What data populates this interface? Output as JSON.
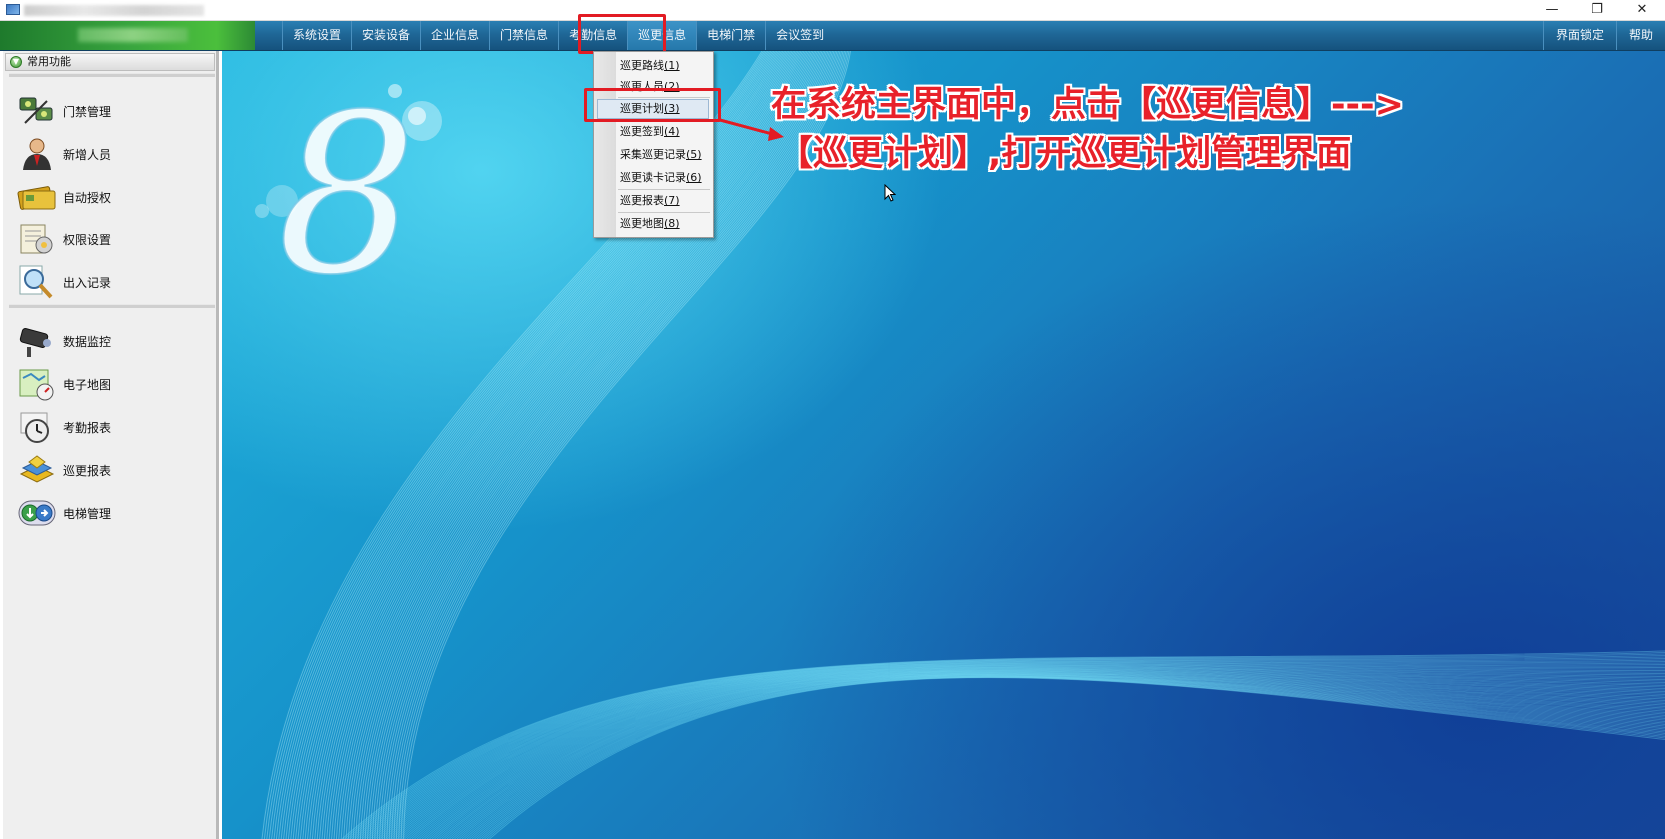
{
  "window": {
    "controls": [
      "—",
      "❐",
      "✕"
    ]
  },
  "menu": {
    "items": [
      "系统设置",
      "安装设备",
      "企业信息",
      "门禁信息",
      "考勤信息",
      "巡更信息",
      "电梯门禁",
      "会议签到"
    ],
    "right_items": [
      "界面锁定",
      "帮助"
    ],
    "active": "巡更信息"
  },
  "sidebar": {
    "title": "常用功能",
    "group1": [
      {
        "label": "门禁管理",
        "icon": "door-access-icon"
      },
      {
        "label": "新增人员",
        "icon": "person-icon"
      },
      {
        "label": "自动授权",
        "icon": "card-icon"
      },
      {
        "label": "权限设置",
        "icon": "permission-icon"
      },
      {
        "label": "出入记录",
        "icon": "magnifier-icon"
      }
    ],
    "group2": [
      {
        "label": "数据监控",
        "icon": "camera-icon"
      },
      {
        "label": "电子地图",
        "icon": "map-icon"
      },
      {
        "label": "考勤报表",
        "icon": "clock-icon"
      },
      {
        "label": "巡更报表",
        "icon": "patrol-report-icon"
      },
      {
        "label": "电梯管理",
        "icon": "elevator-icon"
      }
    ]
  },
  "dropdown": {
    "items": [
      {
        "text": "巡更路线",
        "key": "(1)"
      },
      {
        "text": "巡更人员",
        "key": "(2)"
      },
      {
        "text": "巡更计划",
        "key": "(3)"
      },
      {
        "text": "巡更签到",
        "key": "(4)"
      },
      {
        "text": "采集巡更记录",
        "key": "(5)"
      },
      {
        "text": "巡更读卡记录",
        "key": "(6)"
      },
      {
        "text": "巡更报表",
        "key": "(7)"
      },
      {
        "text": "巡更地图",
        "key": "(8)"
      }
    ]
  },
  "annotation": {
    "line1": "在系统主界面中，点击【巡更信息】--->",
    "line2": "【巡更计划】,打开巡更计划管理界面"
  },
  "logo_char": "8",
  "colors": {
    "accent_red": "#e21b23",
    "menubar": "#1f6797",
    "desktop_blue": "#1692ca"
  }
}
